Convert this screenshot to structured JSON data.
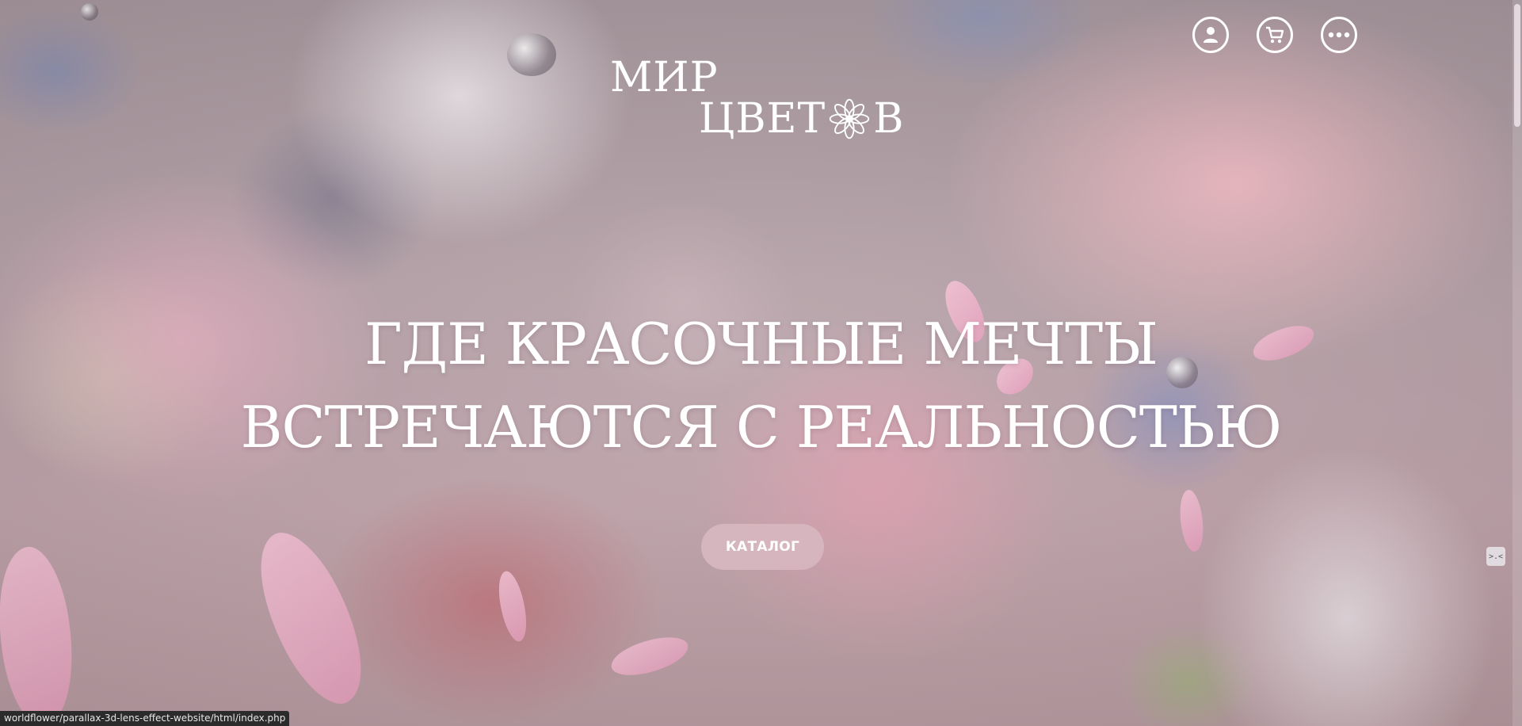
{
  "header": {
    "logo_line1": "МИР",
    "logo_line2_part1": "ЦВЕТ",
    "logo_line2_part2": "В",
    "icons": [
      "user-icon",
      "cart-icon",
      "more-icon"
    ]
  },
  "hero": {
    "title_line1": "ГДЕ КРАСОЧНЫЕ МЕЧТЫ",
    "title_line2": "ВСТРЕЧАЮТСЯ С РЕАЛЬНОСТЬЮ",
    "cta_label": "КАТАЛОГ"
  },
  "side_widget_label": ">.<",
  "status_bar": {
    "url": "worldflower/parallax-3d-lens-effect-website/html/index.php"
  },
  "colors": {
    "text": "#ffffff",
    "button_bg": "#d7b6c0",
    "petal": "#f2b7cd"
  }
}
